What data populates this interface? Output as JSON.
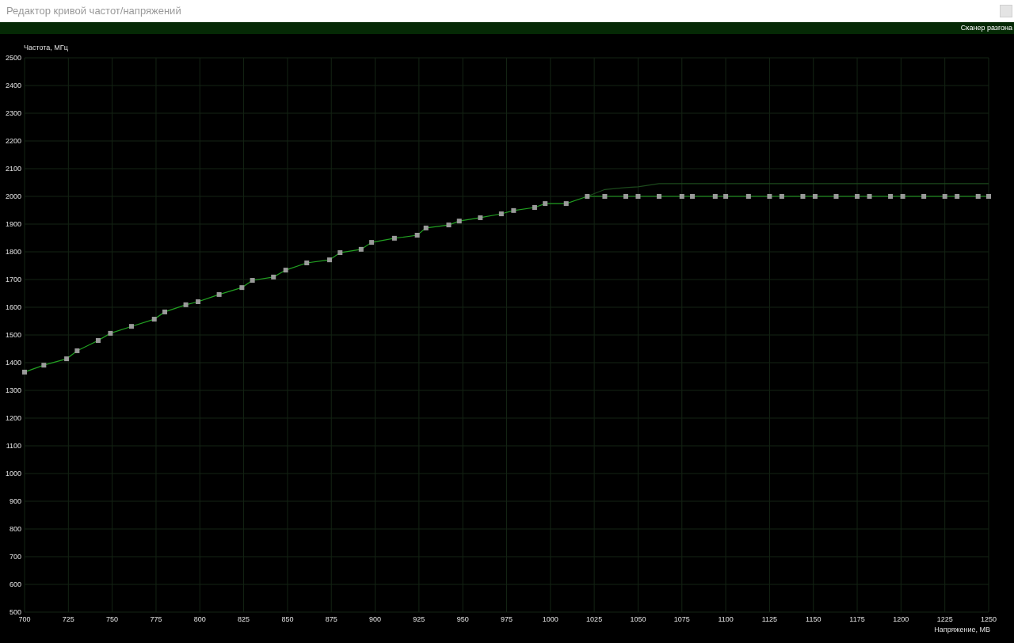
{
  "window": {
    "title": "Редактор кривой частот/напряжений"
  },
  "toolbar": {
    "button": "Сканер разгона"
  },
  "chart": {
    "chart_data": {
      "type": "line",
      "xlabel": "Напряжение, МВ",
      "ylabel": "Частота, МГц",
      "x": [
        700,
        711,
        724,
        730,
        742,
        749,
        761,
        774,
        780,
        792,
        799,
        811,
        824,
        830,
        842,
        849,
        861,
        874,
        880,
        892,
        898,
        911,
        924,
        929,
        942,
        948,
        960,
        972,
        979,
        991,
        997,
        1009,
        1021,
        1031,
        1043,
        1050,
        1062,
        1075,
        1081,
        1094,
        1100,
        1113,
        1125,
        1132,
        1144,
        1151,
        1163,
        1175,
        1182,
        1194,
        1201,
        1213,
        1225,
        1232,
        1244,
        1250
      ],
      "series": [
        {
          "color": "#22a022",
          "marker": "square",
          "values": [
            1366,
            1391,
            1414,
            1443,
            1480,
            1506,
            1531,
            1557,
            1583,
            1609,
            1620,
            1646,
            1671,
            1697,
            1709,
            1734,
            1760,
            1771,
            1797,
            1809,
            1834,
            1849,
            1860,
            1886,
            1897,
            1911,
            1923,
            1937,
            1949,
            1960,
            1974,
            1974,
            2000,
            2000,
            2000,
            2000,
            2000,
            2000,
            2000,
            2000,
            2000,
            2000,
            2000,
            2000,
            2000,
            2000,
            2000,
            2000,
            2000,
            2000,
            2000,
            2000,
            2000,
            2000,
            2000,
            2000
          ]
        },
        {
          "color": "#1d4a1d",
          "values": [
            null,
            null,
            null,
            null,
            null,
            null,
            null,
            null,
            null,
            null,
            null,
            null,
            null,
            null,
            null,
            null,
            null,
            null,
            null,
            null,
            null,
            null,
            null,
            null,
            null,
            null,
            null,
            null,
            null,
            null,
            null,
            null,
            2000,
            2025,
            2032,
            2035,
            2046,
            2046,
            null,
            null,
            null,
            null,
            null,
            null,
            null,
            null,
            null,
            null,
            null,
            null,
            null,
            null,
            null,
            null,
            null,
            2046
          ]
        }
      ],
      "grid": true,
      "xlim": [
        700,
        1250
      ],
      "ylim": [
        500,
        2500
      ],
      "xticks": [
        700,
        725,
        750,
        775,
        800,
        825,
        850,
        875,
        900,
        925,
        950,
        975,
        1000,
        1025,
        1050,
        1075,
        1100,
        1125,
        1150,
        1175,
        1200,
        1225,
        1250
      ],
      "yticks": [
        500,
        600,
        700,
        800,
        900,
        1000,
        1100,
        1200,
        1300,
        1400,
        1500,
        1600,
        1700,
        1800,
        1900,
        2000,
        2100,
        2200,
        2300,
        2400,
        2500
      ]
    }
  }
}
